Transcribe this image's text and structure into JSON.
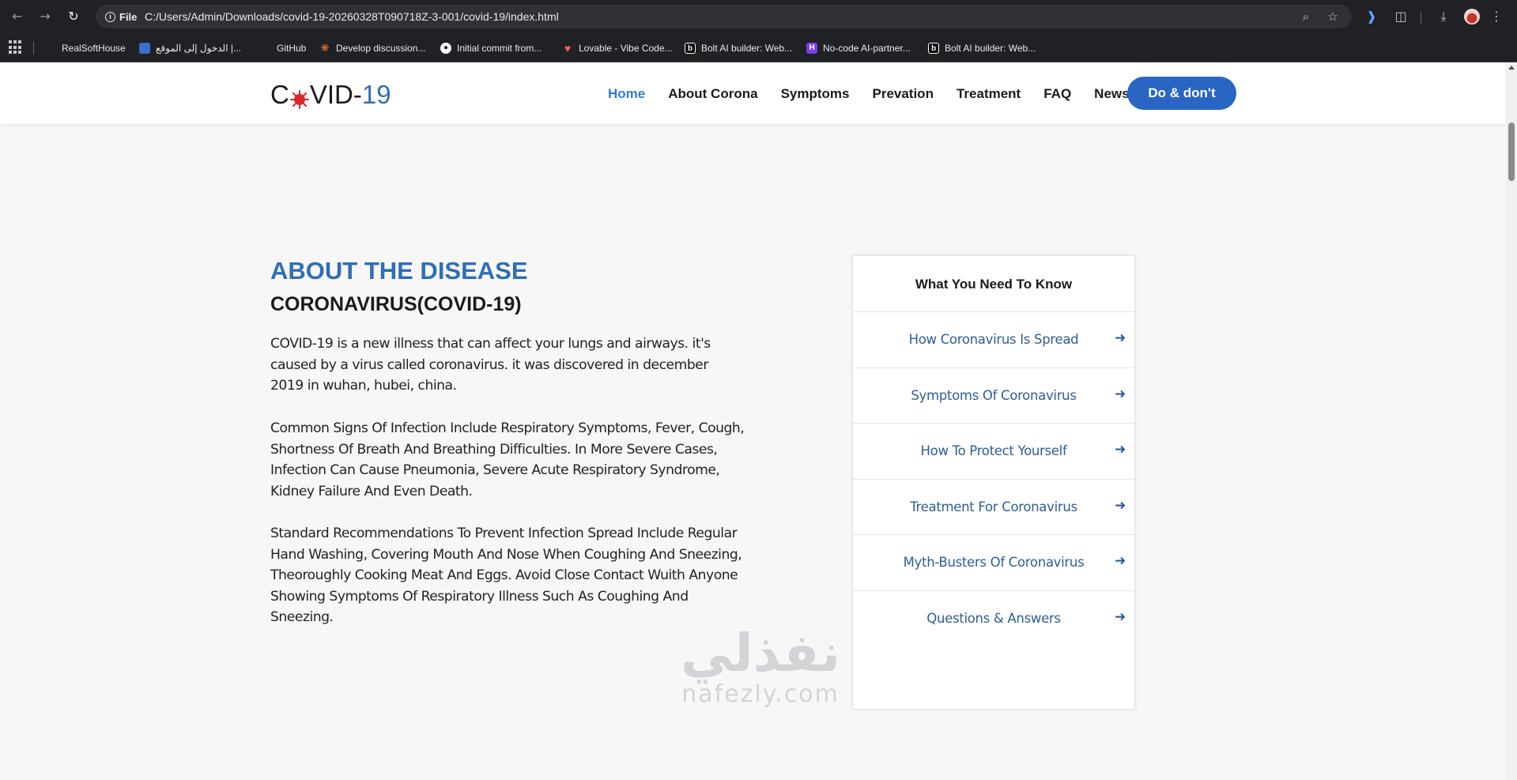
{
  "browser": {
    "url_chip": "File",
    "url": "C:/Users/Admin/Downloads/covid-19-20260328T090718Z-3-001/covid-19/index.html",
    "icons": [
      "back-arrow-icon",
      "forward-arrow-icon",
      "reload-icon",
      "zoom-icon",
      "star-icon",
      "extension-icon",
      "puzzle-icon",
      "download-icon",
      "menu-icon"
    ],
    "bookmarks": [
      {
        "label": "RealSoftHouse",
        "color": "#202124"
      },
      {
        "label": "الدخول إلى الموقع |...",
        "color": "#3b6fd1"
      },
      {
        "label": "GitHub",
        "color": "#202124"
      },
      {
        "label": "Develop discussion...",
        "color": "#d96b3b"
      },
      {
        "label": "Initial commit from...",
        "color": "#ffffff"
      },
      {
        "label": "Lovable - Vibe Code...",
        "color": "#ff5a5f"
      },
      {
        "label": "Bolt AI builder: Web...",
        "color": "#000000"
      },
      {
        "label": "No-code AI-partner...",
        "color": "#7b3fe4"
      },
      {
        "label": "Bolt AI builder: Web...",
        "color": "#000000"
      }
    ]
  },
  "site": {
    "logo_prefix": "C",
    "logo_middle": "VID-",
    "logo_number": "19",
    "nav": [
      "Home",
      "About Corona",
      "Symptoms",
      "Prevation",
      "Treatment",
      "FAQ",
      "News"
    ],
    "cta": "Do & don't",
    "accent_color": "#2966c4"
  },
  "about": {
    "kicker": "ABOUT THE DISEASE",
    "title": "CORONAVIRUS(COVID-19)",
    "paragraphs": [
      "COVID-19 is a new illness that can affect your lungs and airways. it's caused by a virus called coronavirus. it was discovered in december 2019 in wuhan, hubei, china.",
      "Common Signs Of Infection Include Respiratory Symptoms, Fever, Cough, Shortness Of Breath And Breathing Difficulties. In More Severe Cases, Infection Can Cause Pneumonia, Severe Acute Respiratory Syndrome, Kidney Failure And Even Death.",
      "Standard Recommendations To Prevent Infection Spread Include Regular Hand Washing, Covering Mouth And Nose When Coughing And Sneezing, Theoroughly Cooking Meat And Eggs. Avoid Close Contact Wuith Anyone Showing Symptoms Of Respiratory Illness Such As Coughing And Sneezing."
    ]
  },
  "know": {
    "heading": "What You Need To Know",
    "items": [
      "How Coronavirus Is Spread",
      "Symptoms Of Coronavirus",
      "How To Protect Yourself",
      "Treatment For Coronavirus",
      "Myth-Busters Of Coronavirus",
      "Questions & Answers"
    ]
  },
  "watermark": {
    "arabic": "نفذلي",
    "latin": "nafezly.com"
  }
}
